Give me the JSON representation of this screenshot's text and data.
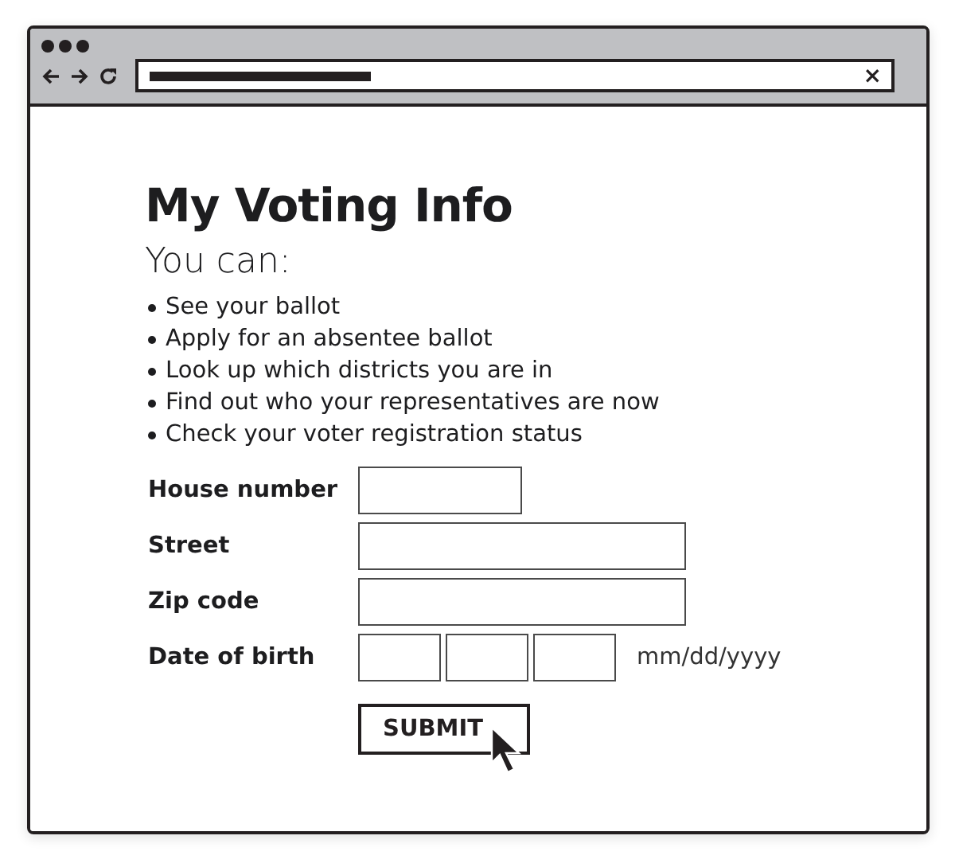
{
  "browser": {
    "clear_button": "×"
  },
  "page": {
    "title": "My Voting Info",
    "subtitle": "You can:",
    "bullets": [
      "See your ballot",
      "Apply for an absentee ballot",
      "Look up which districts you are in",
      "Find out who your representatives are now",
      "Check your voter registration status"
    ],
    "form": [
      {
        "label": "House number",
        "kind": "short"
      },
      {
        "label": "Street",
        "kind": "long"
      },
      {
        "label": "Zip code",
        "kind": "long"
      },
      {
        "label": "Date of birth",
        "kind": "date",
        "hint": "mm/dd/yyyy"
      }
    ],
    "submit": "SUBMIT"
  }
}
